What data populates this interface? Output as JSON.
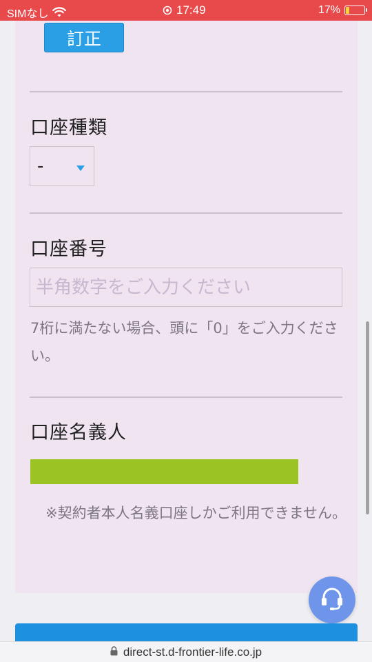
{
  "status_bar": {
    "carrier": "SIMなし",
    "time": "17:49",
    "battery_percent": "17%",
    "battery_level": 0.17,
    "icons": [
      "wifi-icon",
      "alarm-icon",
      "battery-icon"
    ]
  },
  "form": {
    "fix_button_label": "訂正",
    "account_type": {
      "label": "口座種類",
      "selected": "-"
    },
    "account_number": {
      "label": "口座番号",
      "placeholder": "半角数字をご入力ください",
      "help": "7桁に満たない場合、頭に「0」をご入力ください。"
    },
    "account_holder": {
      "label": "口座名義人",
      "note": "※契約者本人名義口座しかご利用できません。"
    }
  },
  "url_bar": {
    "url": "direct-st.d-frontier-life.co.jp",
    "icon": "lock-icon"
  },
  "colors": {
    "status_bar": "#e84a4c",
    "accent_blue": "#2a9fe6",
    "holder_bar": "#9bc324",
    "panel_bg": "#f1e4f1",
    "fab": "#6e95ea"
  }
}
